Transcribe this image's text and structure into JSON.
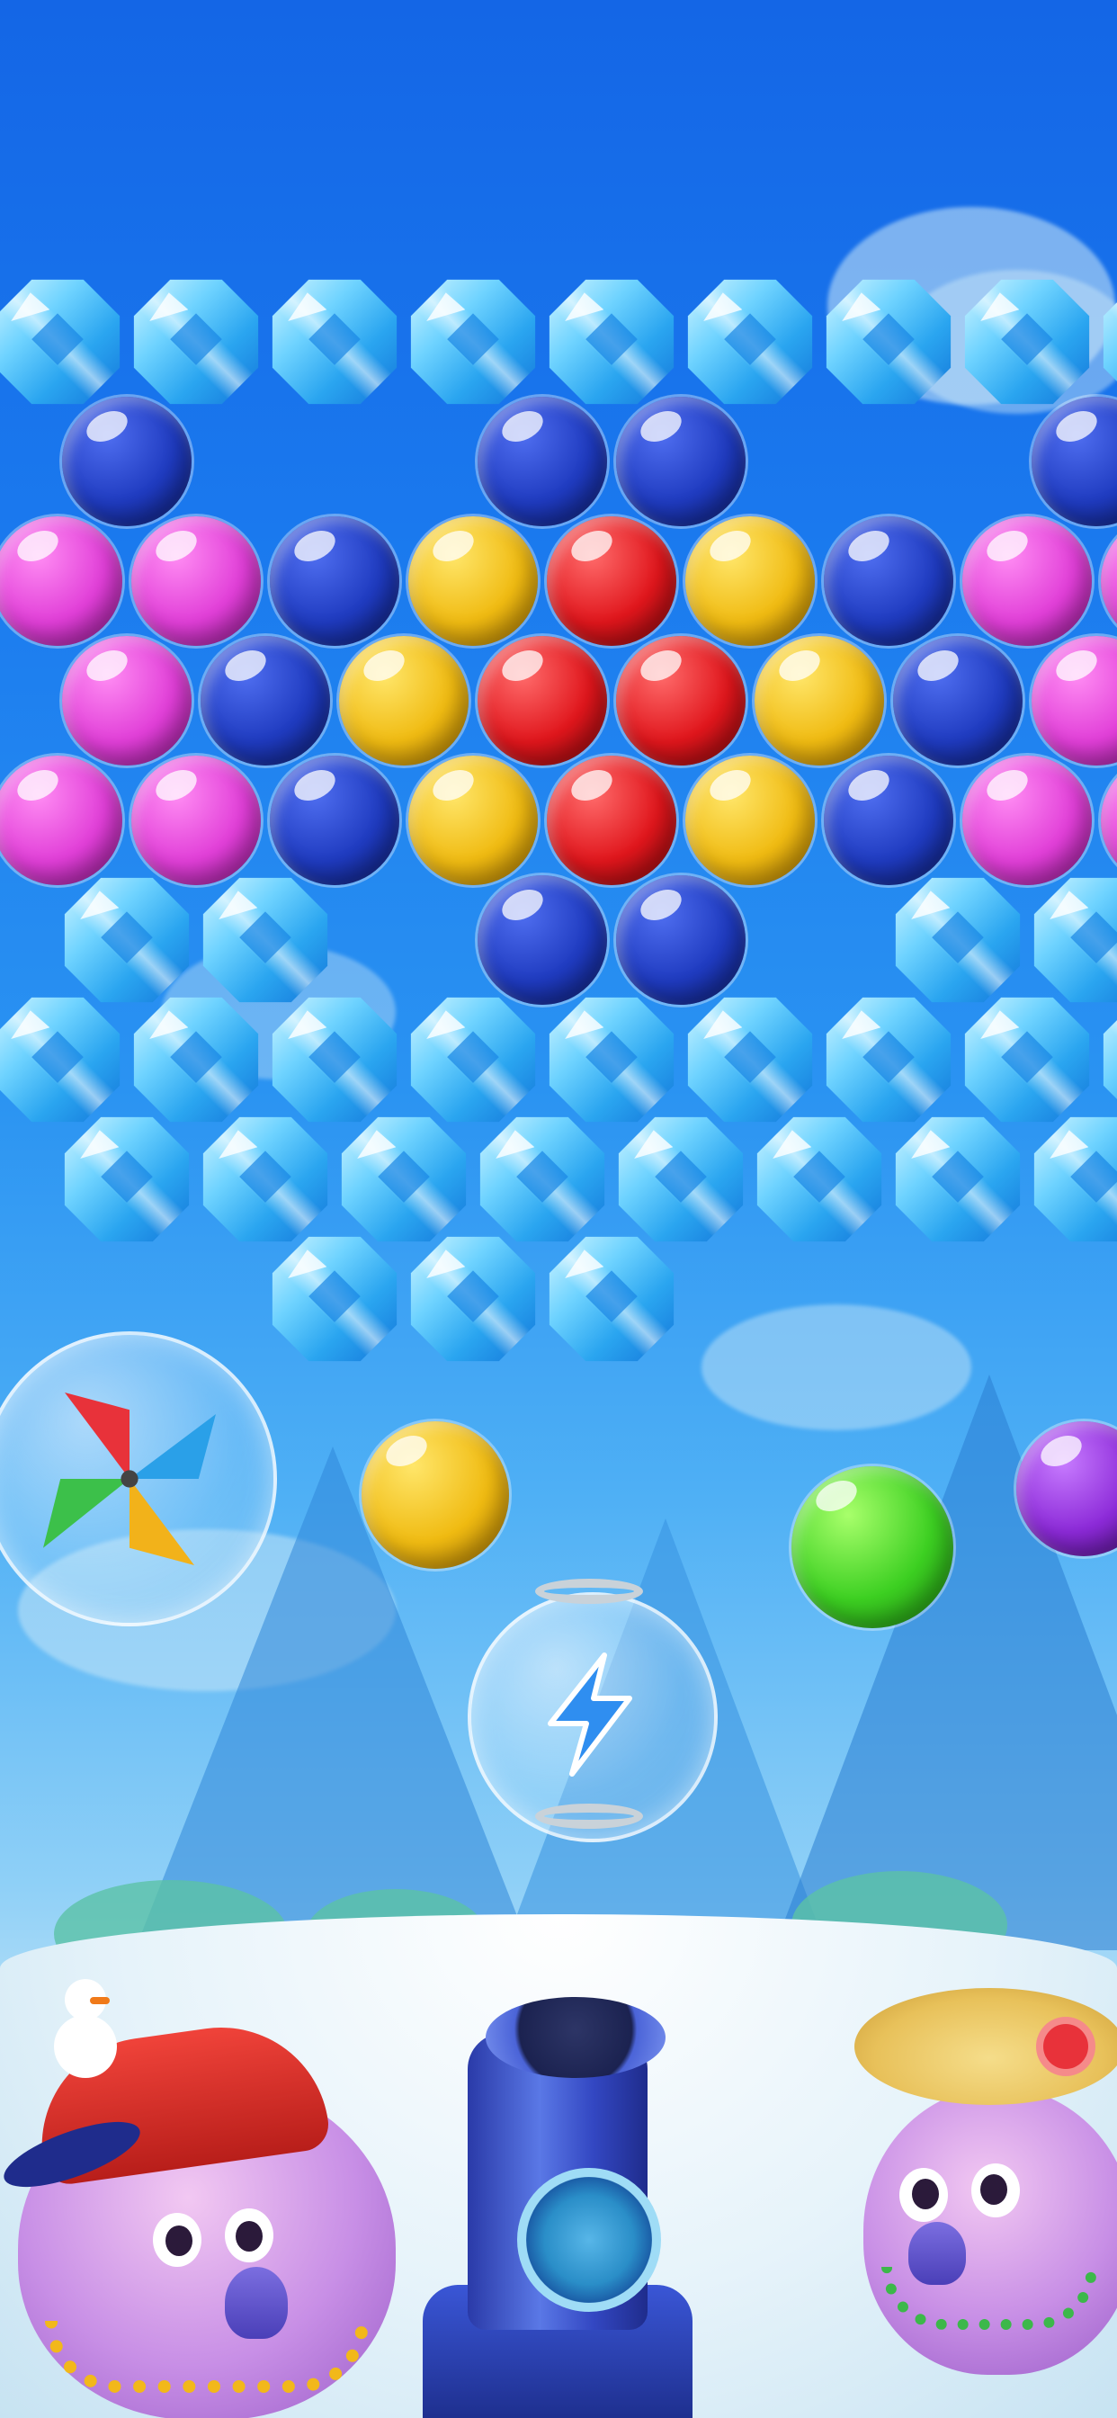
{
  "game": {
    "grid": {
      "rows": [
        [
          "ice",
          "ice",
          "ice",
          "ice",
          "ice",
          "ice",
          "ice",
          "ice",
          "ice"
        ],
        [
          "blue",
          "",
          "",
          "blue",
          "blue",
          "",
          "",
          "blue"
        ],
        [
          "pink",
          "pink",
          "blue",
          "yellow",
          "red",
          "yellow",
          "blue",
          "pink",
          "pink"
        ],
        [
          "pink",
          "blue",
          "yellow",
          "red",
          "red",
          "yellow",
          "blue",
          "pink"
        ],
        [
          "pink",
          "pink",
          "blue",
          "yellow",
          "red",
          "yellow",
          "blue",
          "pink",
          "pink"
        ],
        [
          "ice",
          "ice",
          "",
          "blue",
          "blue",
          "",
          "ice",
          "ice"
        ],
        [
          "ice",
          "ice",
          "ice",
          "ice",
          "ice",
          "ice",
          "ice",
          "ice",
          "ice"
        ],
        [
          "ice",
          "ice",
          "ice",
          "ice",
          "ice",
          "ice",
          "ice",
          "ice"
        ],
        [
          "",
          "",
          "ice",
          "ice",
          "ice",
          "",
          "",
          "",
          ""
        ]
      ]
    },
    "shooter": {
      "current_bubble": "yellow",
      "next_bubble": "green",
      "spare_bubble": "purple"
    },
    "boosters": [
      {
        "name": "pinwheel",
        "icon": "pinwheel-icon"
      },
      {
        "name": "lightning",
        "icon": "lightning-icon"
      }
    ],
    "colors": {
      "blue": "#1f3bc0",
      "pink": "#e13fd8",
      "yellow": "#f0bb12",
      "red": "#e0161c",
      "green": "#3dd022",
      "purple": "#8c2ad8",
      "ice": "#6fd3ff"
    }
  }
}
